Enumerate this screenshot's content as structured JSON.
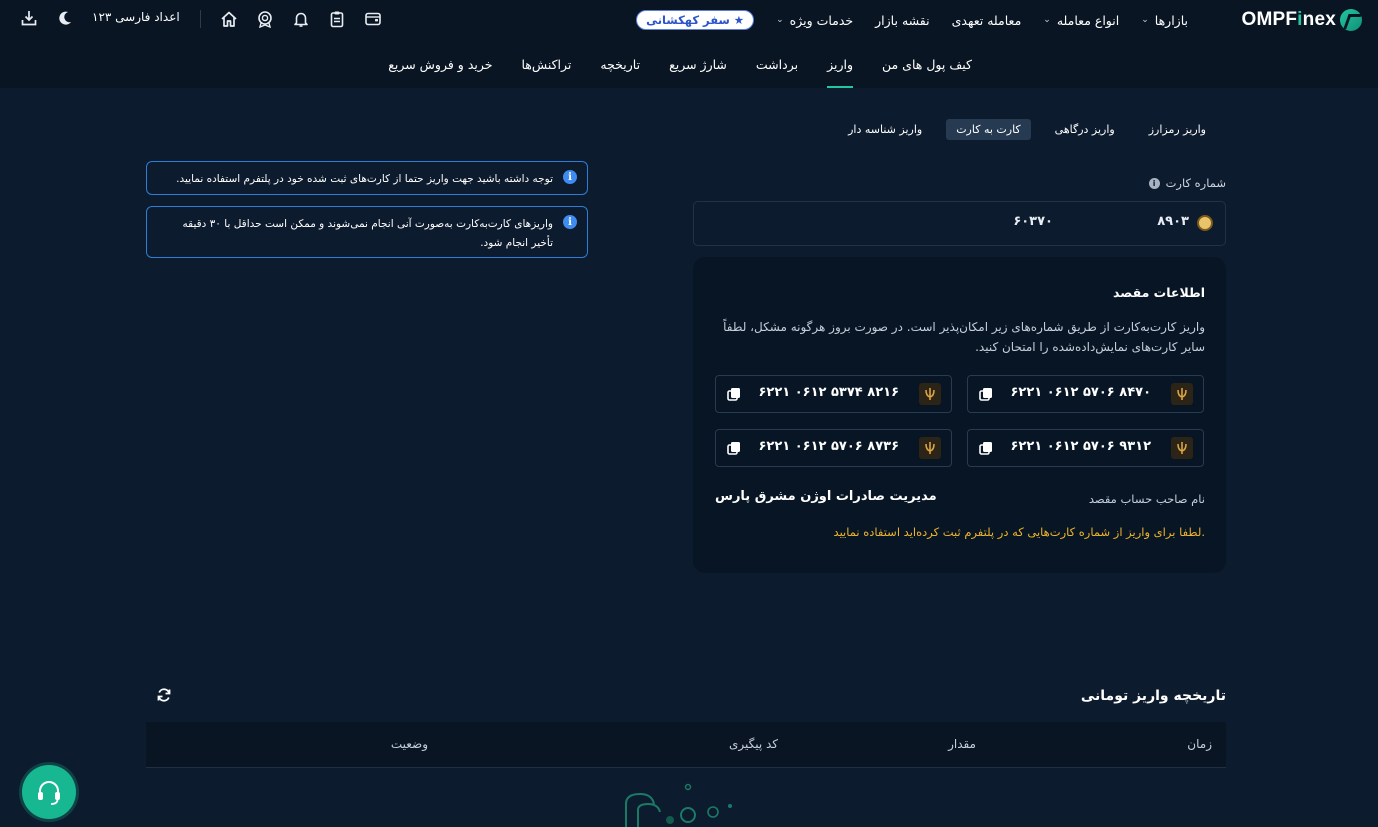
{
  "header": {
    "brand": {
      "prefix": "OMPF",
      "accent": "i",
      "suffix": "nex"
    },
    "nav": [
      {
        "label": "بازارها",
        "has_dropdown": true
      },
      {
        "label": "انواع معامله",
        "has_dropdown": true
      },
      {
        "label": "معامله تعهدی",
        "has_dropdown": false
      },
      {
        "label": "نقشه بازار",
        "has_dropdown": false
      },
      {
        "label": "خدمات ویژه",
        "has_dropdown": true
      }
    ],
    "galaxy_badge": "سفر کهکشانی",
    "number_setting": "اعداد فارسی ۱۲۳",
    "icons": [
      "wallet-icon",
      "clipboard-icon",
      "bell-icon",
      "rewards-icon",
      "home-icon",
      "moon-icon",
      "download-icon"
    ]
  },
  "subnav": {
    "tabs": [
      {
        "label": "کیف پول های من",
        "active": false
      },
      {
        "label": "واریز",
        "active": true
      },
      {
        "label": "برداشت",
        "active": false
      },
      {
        "label": "شارژ سریع",
        "active": false
      },
      {
        "label": "تاریخچه",
        "active": false
      },
      {
        "label": "تراکنش‌ها",
        "active": false
      },
      {
        "label": "خرید و فروش سریع",
        "active": false
      }
    ]
  },
  "deposit_methods": [
    {
      "label": "واریز رمزارز",
      "active": false
    },
    {
      "label": "واریز درگاهی",
      "active": false
    },
    {
      "label": "کارت به کارت",
      "active": true
    },
    {
      "label": "واریز شناسه دار",
      "active": false
    }
  ],
  "notices": [
    "توجه داشته باشید جهت واریز حتما از کارت‌های ثبت شده خود در پلتفرم استفاده نمایید.",
    "واریزهای کارت‌به‌کارت به‌صورت آنی انجام نمی‌شوند و ممکن است حداقل با ۳۰ دقیقه تأخیر انجام شود."
  ],
  "card_number": {
    "label": "شماره کارت",
    "part_start": "۸۹۰۳",
    "part_end": "۶۰۳۷۰"
  },
  "destination": {
    "title": "اطلاعات مقصد",
    "description": "واریز کارت‌به‌کارت از طریق شماره‌های زیر امکان‌پذیر است. در صورت بروز هرگونه مشکل، لطفاً سایر کارت‌های نمایش‌داده‌شده را امتحان کنید.",
    "cards": [
      "۶۲۲۱ ۰۶۱۲ ۵۷۰۶ ۸۴۷۰",
      "۶۲۲۱ ۰۶۱۲ ۵۳۷۴ ۸۲۱۶",
      "۶۲۲۱ ۰۶۱۲ ۵۷۰۶ ۹۳۱۲",
      "۶۲۲۱ ۰۶۱۲ ۵۷۰۶ ۸۷۳۶"
    ],
    "owner_label": "نام صاحب حساب مقصد",
    "owner_name": "مدیریت صادرات اوژن مشرق پارس",
    "warning": "لطفا برای واریز از شماره کارت‌هایی که در پلتفرم ثبت کرده‌اید استفاده نمایید."
  },
  "history": {
    "title": "تاریخچه واریز تومانی",
    "columns": [
      "زمان",
      "مقدار",
      "کد پیگیری",
      "وضعیت"
    ]
  },
  "colors": {
    "background": "#0d1b2e",
    "header": "#091523",
    "accent": "#22c7a2",
    "info": "#2e7dd6",
    "warning": "#f0b429"
  }
}
